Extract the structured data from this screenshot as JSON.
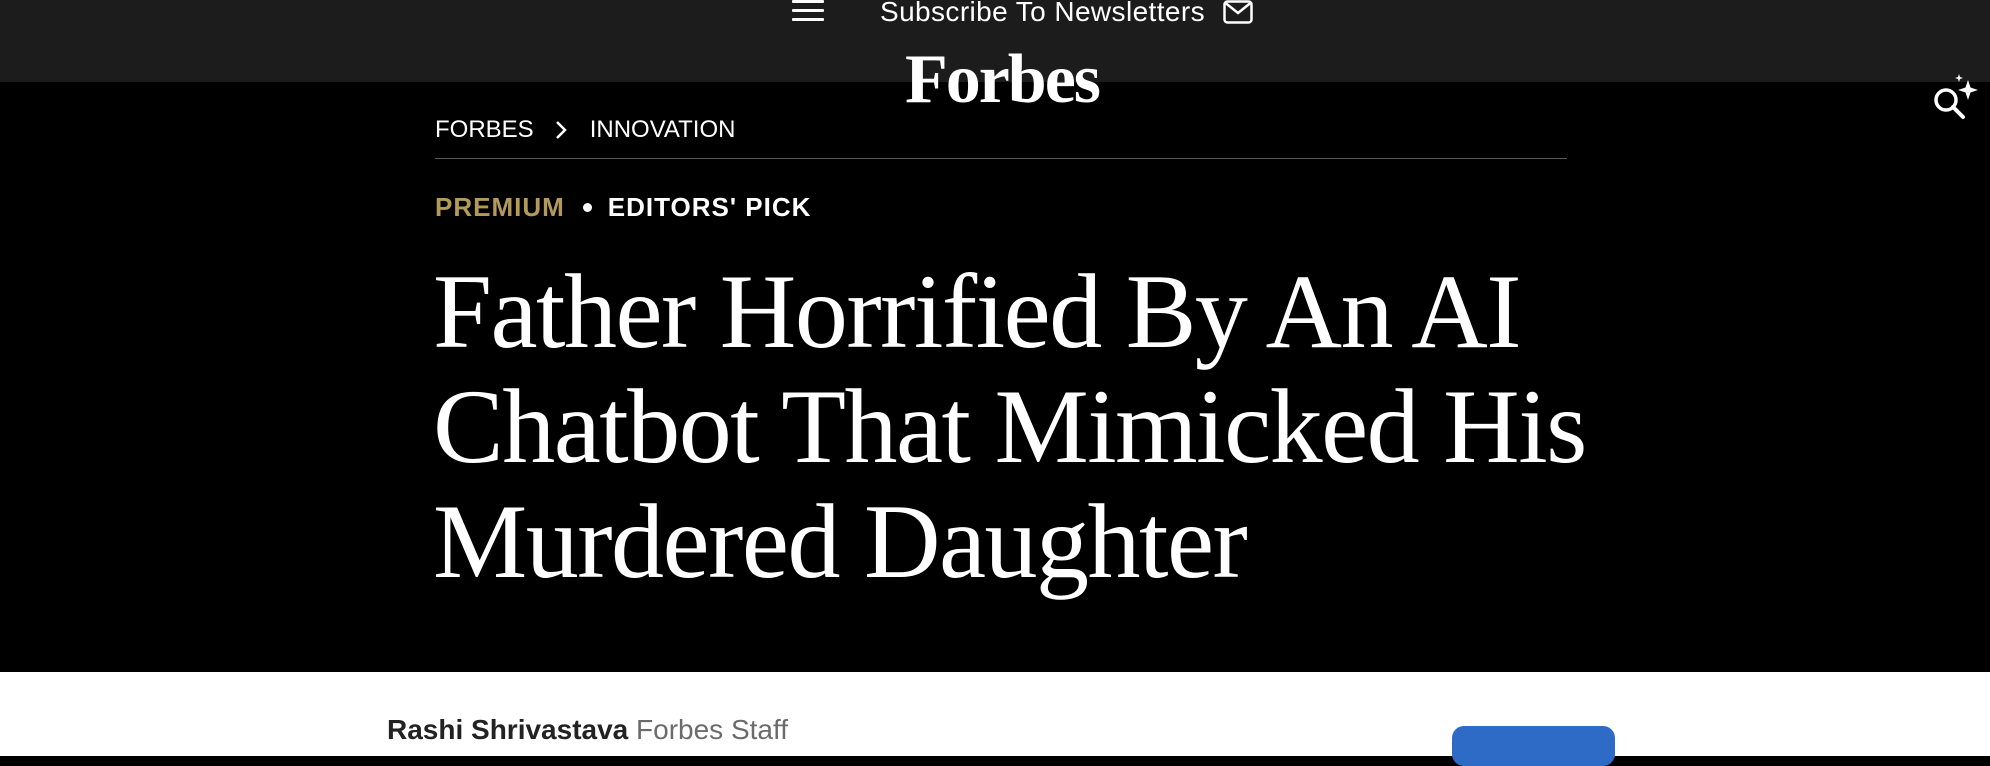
{
  "header": {
    "menu_icon": "hamburger-menu-icon",
    "subscribe_label": "Subscribe To Newsletters",
    "mail_icon": "envelope-icon",
    "logo_text": "Forbes",
    "search_icon": "ai-search-sparkle-icon"
  },
  "breadcrumb": {
    "items": [
      "FORBES",
      "INNOVATION"
    ],
    "separator_icon": "chevron-right-icon"
  },
  "tags": {
    "premium": "PREMIUM",
    "editors_pick": "EDITORS' PICK"
  },
  "article": {
    "headline_lines": [
      "Father Horrified By An AI",
      "Chatbot That Mimicked His",
      "Murdered Daughter"
    ],
    "author": "Rashi Shrivastava",
    "author_role": "Forbes Staff"
  },
  "colors": {
    "topbar": "#1c1c1c",
    "hero_background": "#000000",
    "premium_gold": "#b39a5b",
    "follow_button_blue": "#2e6bc6"
  }
}
